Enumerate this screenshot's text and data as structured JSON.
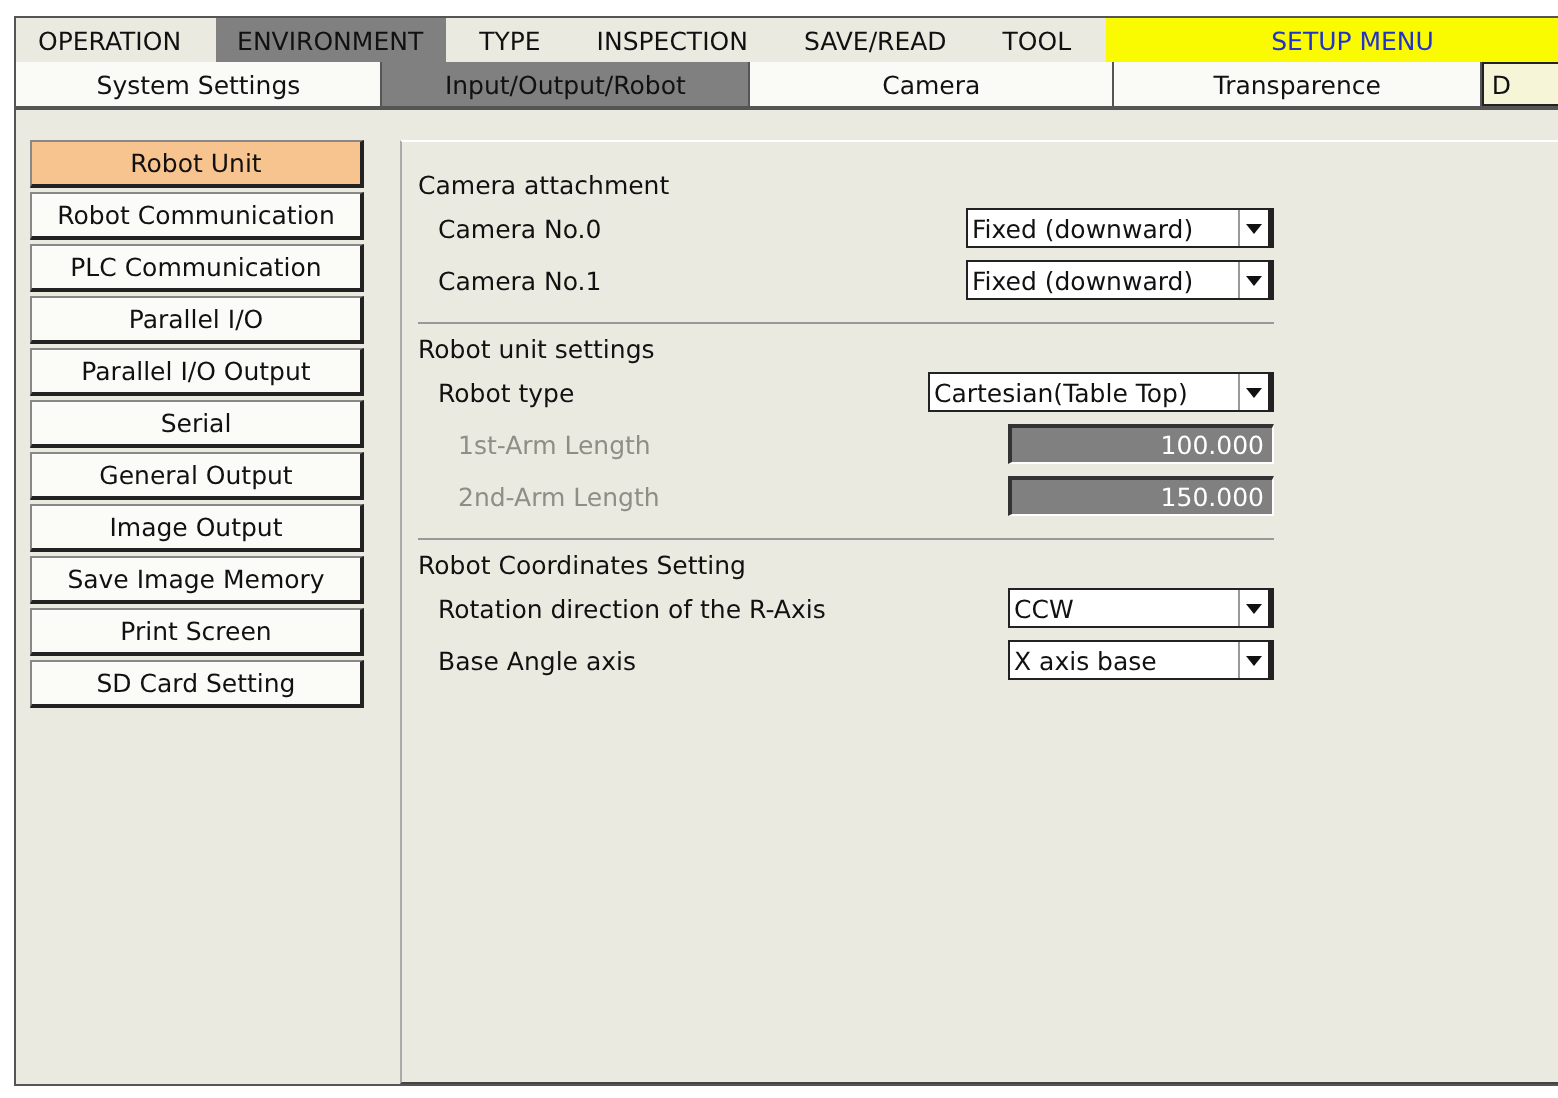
{
  "menu": [
    {
      "label": "OPERATION",
      "selected": false
    },
    {
      "label": "ENVIRONMENT",
      "selected": true
    },
    {
      "label": "TYPE",
      "selected": false
    },
    {
      "label": "INSPECTION",
      "selected": false
    },
    {
      "label": "SAVE/READ",
      "selected": false
    },
    {
      "label": "TOOL",
      "selected": false
    }
  ],
  "setup_menu": "SETUP MENU",
  "tabs": [
    {
      "label": "System Settings",
      "selected": false
    },
    {
      "label": "Input/Output/Robot",
      "selected": true
    },
    {
      "label": "Camera",
      "selected": false
    },
    {
      "label": "Transparence",
      "selected": false
    },
    {
      "label": "D",
      "selected": false
    }
  ],
  "sidebar": {
    "items": [
      {
        "label": "Robot Unit",
        "selected": true
      },
      {
        "label": "Robot Communication",
        "selected": false
      },
      {
        "label": "PLC Communication",
        "selected": false
      },
      {
        "label": "Parallel I/O",
        "selected": false
      },
      {
        "label": "Parallel I/O Output",
        "selected": false
      },
      {
        "label": "Serial",
        "selected": false
      },
      {
        "label": "General Output",
        "selected": false
      },
      {
        "label": "Image Output",
        "selected": false
      },
      {
        "label": "Save Image Memory",
        "selected": false
      },
      {
        "label": "Print Screen",
        "selected": false
      },
      {
        "label": "SD Card Setting",
        "selected": false
      }
    ]
  },
  "sections": [
    {
      "title": "Camera attachment",
      "rows": [
        {
          "label": "Camera No.0",
          "kind": "select",
          "value": "Fixed (downward)",
          "disabled": false
        },
        {
          "label": "Camera No.1",
          "kind": "select",
          "value": "Fixed (downward)",
          "disabled": false
        }
      ]
    },
    {
      "title": "Robot unit settings",
      "rows": [
        {
          "label": "Robot type",
          "kind": "select",
          "value": "Cartesian(Table Top)",
          "disabled": false
        },
        {
          "label": "1st-Arm Length",
          "kind": "number",
          "value": "100.000",
          "disabled": true
        },
        {
          "label": "2nd-Arm Length",
          "kind": "number",
          "value": "150.000",
          "disabled": true
        }
      ]
    },
    {
      "title": "Robot Coordinates Setting",
      "rows": [
        {
          "label": "Rotation direction of the R-Axis",
          "kind": "select",
          "value": "CCW",
          "disabled": false
        },
        {
          "label": "Base Angle axis",
          "kind": "select",
          "value": "X axis base",
          "disabled": false
        }
      ]
    }
  ]
}
